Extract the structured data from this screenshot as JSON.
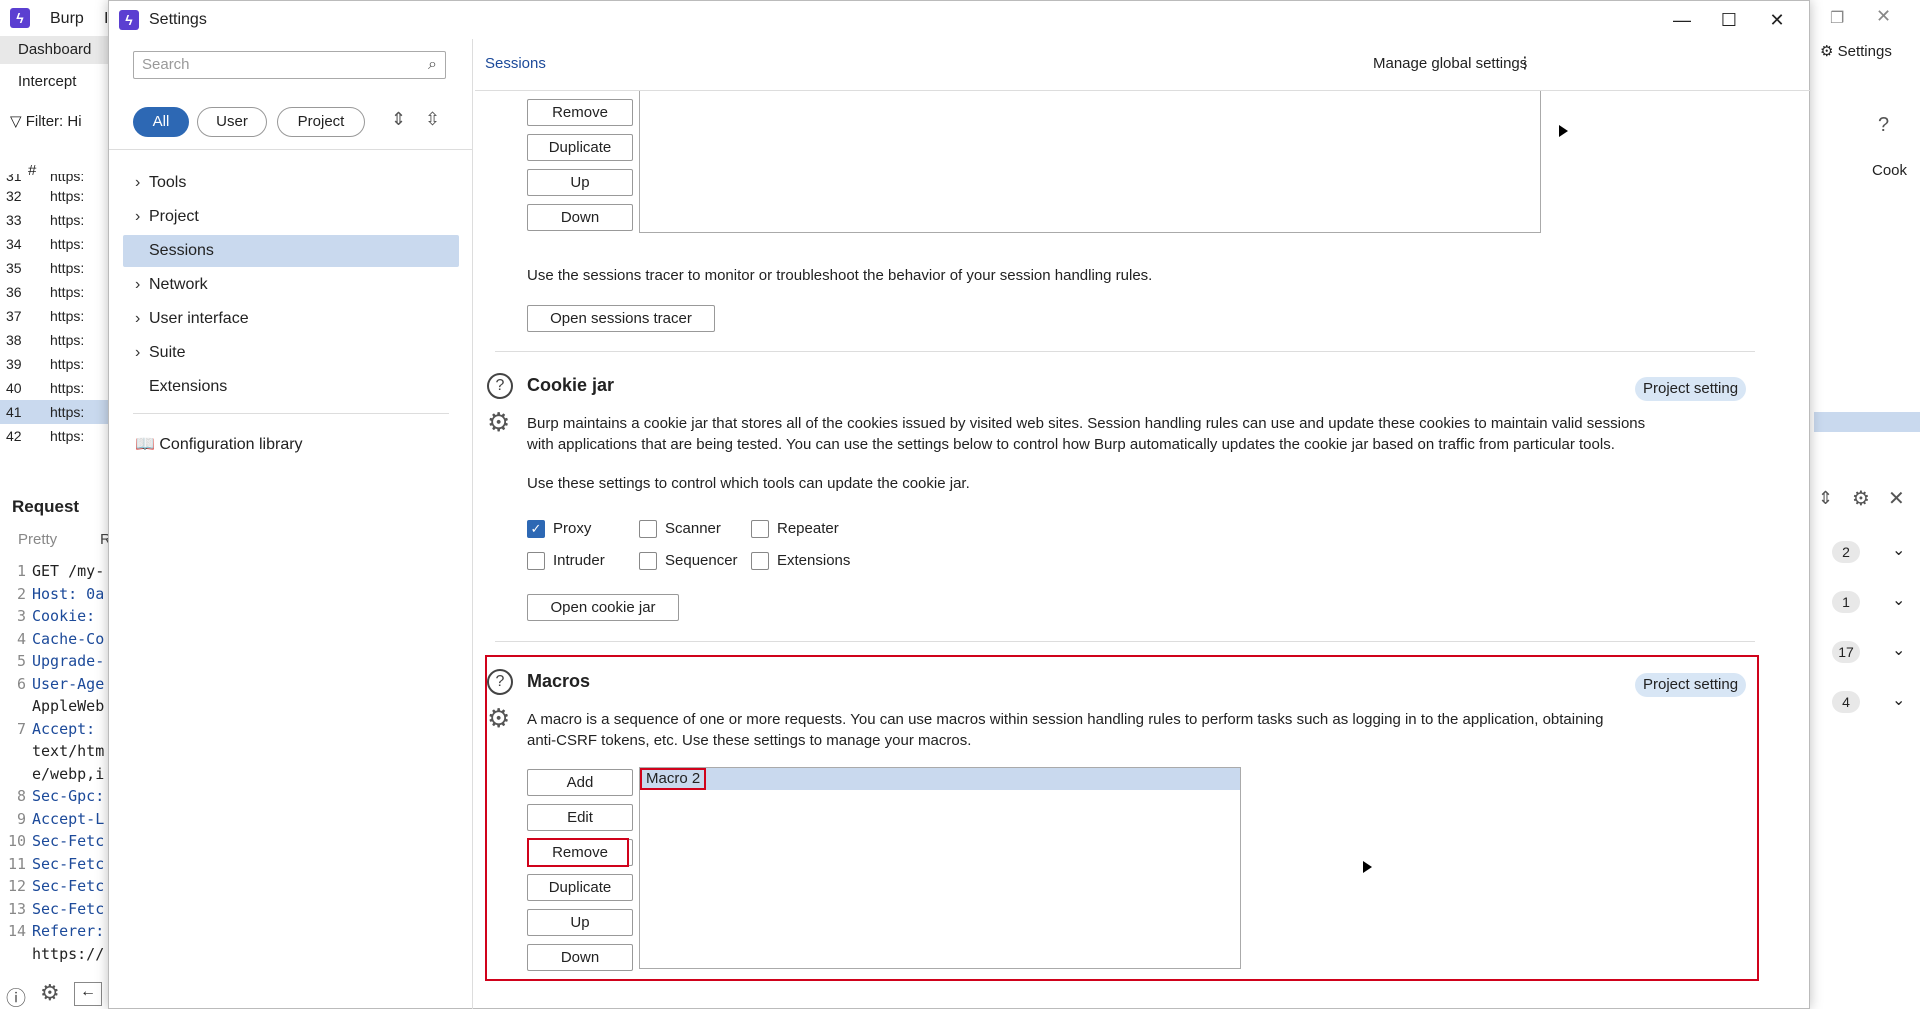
{
  "app": {
    "title": "Burp",
    "title_extra": "I",
    "tabs": [
      "Dashboard",
      "Intercept"
    ],
    "filter_label": "Filter: Hi",
    "table_header": "#",
    "rows": [
      {
        "num": "31",
        "url": "https:"
      },
      {
        "num": "32",
        "url": "https:"
      },
      {
        "num": "33",
        "url": "https:"
      },
      {
        "num": "34",
        "url": "https:"
      },
      {
        "num": "35",
        "url": "https:"
      },
      {
        "num": "36",
        "url": "https:"
      },
      {
        "num": "37",
        "url": "https:"
      },
      {
        "num": "38",
        "url": "https:"
      },
      {
        "num": "39",
        "url": "https:"
      },
      {
        "num": "40",
        "url": "https:"
      },
      {
        "num": "41",
        "url": "https:"
      },
      {
        "num": "42",
        "url": "https:"
      }
    ],
    "request_title": "Request",
    "request_tabs": [
      "Pretty",
      "R"
    ],
    "code_lines": [
      {
        "n": "1",
        "text": "GET /my-"
      },
      {
        "n": "2",
        "text": "Host: 0a"
      },
      {
        "n": "3",
        "text": "Cookie: "
      },
      {
        "n": "4",
        "text": "Cache-Co"
      },
      {
        "n": "5",
        "text": "Upgrade-"
      },
      {
        "n": "6",
        "text": "User-Age"
      },
      {
        "n": "",
        "text": "AppleWeb"
      },
      {
        "n": "7",
        "text": "Accept: "
      },
      {
        "n": "",
        "text": "text/htm"
      },
      {
        "n": "",
        "text": "e/webp,i"
      },
      {
        "n": "8",
        "text": "Sec-Gpc:"
      },
      {
        "n": "9",
        "text": "Accept-L"
      },
      {
        "n": "10",
        "text": "Sec-Fetc"
      },
      {
        "n": "11",
        "text": "Sec-Fetc"
      },
      {
        "n": "12",
        "text": "Sec-Fetc"
      },
      {
        "n": "13",
        "text": "Sec-Fetc"
      },
      {
        "n": "14",
        "text": "Referer:"
      },
      {
        "n": "",
        "text": "https://"
      }
    ],
    "right_settings": "Settings",
    "right_col_header": "Cook",
    "right_counts": [
      "2",
      "1",
      "17",
      "4"
    ]
  },
  "dialog": {
    "title": "Settings",
    "search_placeholder": "Search",
    "filters": [
      "All",
      "User",
      "Project"
    ],
    "nav": [
      {
        "label": "Tools",
        "chevron": true
      },
      {
        "label": "Project",
        "chevron": true
      },
      {
        "label": "Sessions",
        "chevron": false,
        "selected": true
      },
      {
        "label": "Network",
        "chevron": true
      },
      {
        "label": "User interface",
        "chevron": true
      },
      {
        "label": "Suite",
        "chevron": true
      },
      {
        "label": "Extensions",
        "chevron": false
      }
    ],
    "config_library": "Configuration library",
    "breadcrumb": "Sessions",
    "manage_global": "Manage global settings",
    "rules_buttons": [
      "Remove",
      "Duplicate",
      "Up",
      "Down"
    ],
    "tracer_text": "Use the sessions tracer to monitor or troubleshoot the behavior of your session handling rules.",
    "tracer_button": "Open sessions tracer",
    "cookie_jar": {
      "title": "Cookie jar",
      "badge": "Project setting",
      "desc1": "Burp maintains a cookie jar that stores all of the cookies issued by visited web sites. Session handling rules can use and update these cookies to maintain valid sessions",
      "desc2": "with applications that are being tested. You can use the settings below to control how Burp automatically updates the cookie jar based on traffic from particular tools.",
      "desc3": "Use these settings to control which tools can update the cookie jar.",
      "tools": [
        {
          "label": "Proxy",
          "checked": true
        },
        {
          "label": "Scanner",
          "checked": false
        },
        {
          "label": "Repeater",
          "checked": false
        },
        {
          "label": "Intruder",
          "checked": false
        },
        {
          "label": "Sequencer",
          "checked": false
        },
        {
          "label": "Extensions",
          "checked": false
        }
      ],
      "open_button": "Open cookie jar"
    },
    "macros": {
      "title": "Macros",
      "badge": "Project setting",
      "desc1": "A macro is a sequence of one or more requests. You can use macros within session handling rules to perform tasks such as logging in to the application, obtaining",
      "desc2": "anti-CSRF tokens, etc. Use these settings to manage your macros.",
      "buttons": [
        "Add",
        "Edit",
        "Remove",
        "Duplicate",
        "Up",
        "Down"
      ],
      "items": [
        "Macro 2"
      ]
    }
  },
  "colors": {
    "accent": "#2d68b4",
    "highlight": "#d0021b",
    "selection": "#c9d9ee",
    "brand": "#5b3fd1"
  }
}
